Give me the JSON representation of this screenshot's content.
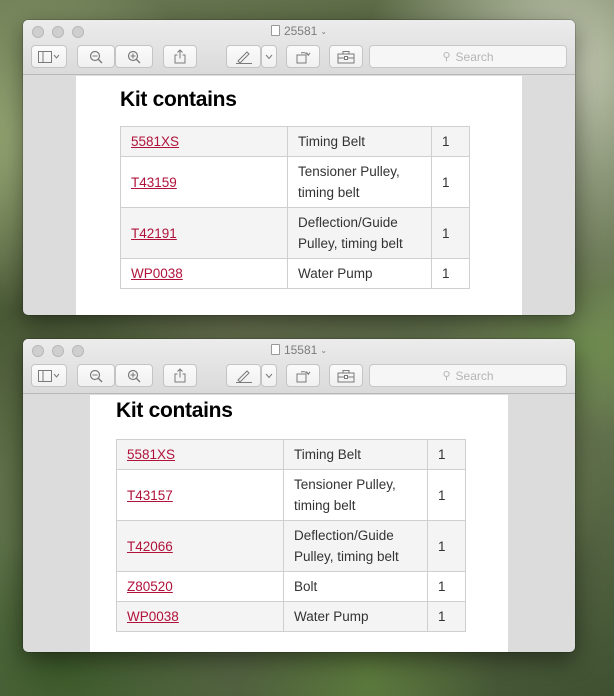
{
  "windows": [
    {
      "title": "25581",
      "search_placeholder": "Search",
      "heading": "Kit contains",
      "rows": [
        {
          "part": "5581XS",
          "description": "Timing Belt",
          "qty": "1"
        },
        {
          "part": "T43159",
          "description": "Tensioner Pulley, timing belt",
          "qty": "1"
        },
        {
          "part": "T42191",
          "description": "Deflection/Guide Pulley, timing belt",
          "qty": "1"
        },
        {
          "part": "WP0038",
          "description": "Water Pump",
          "qty": "1"
        }
      ]
    },
    {
      "title": "15581",
      "search_placeholder": "Search",
      "heading": "Kit contains",
      "rows": [
        {
          "part": "5581XS",
          "description": "Timing Belt",
          "qty": "1"
        },
        {
          "part": "T43157",
          "description": "Tensioner Pulley, timing belt",
          "qty": "1"
        },
        {
          "part": "T42066",
          "description": "Deflection/Guide Pulley, timing belt",
          "qty": "1"
        },
        {
          "part": "Z80520",
          "description": "Bolt",
          "qty": "1"
        },
        {
          "part": "WP0038",
          "description": "Water Pump",
          "qty": "1"
        }
      ]
    }
  ],
  "icons": {
    "sidebar": "sidebar-icon",
    "zoom_out": "zoom-out-icon",
    "zoom_in": "zoom-in-icon",
    "share": "share-icon",
    "markup": "markup-pen-icon",
    "rotate": "rotate-icon",
    "toolbox": "toolbox-icon",
    "search": "search-icon"
  },
  "colors": {
    "link": "#b0123a",
    "row_alt": "#f4f4f4"
  }
}
